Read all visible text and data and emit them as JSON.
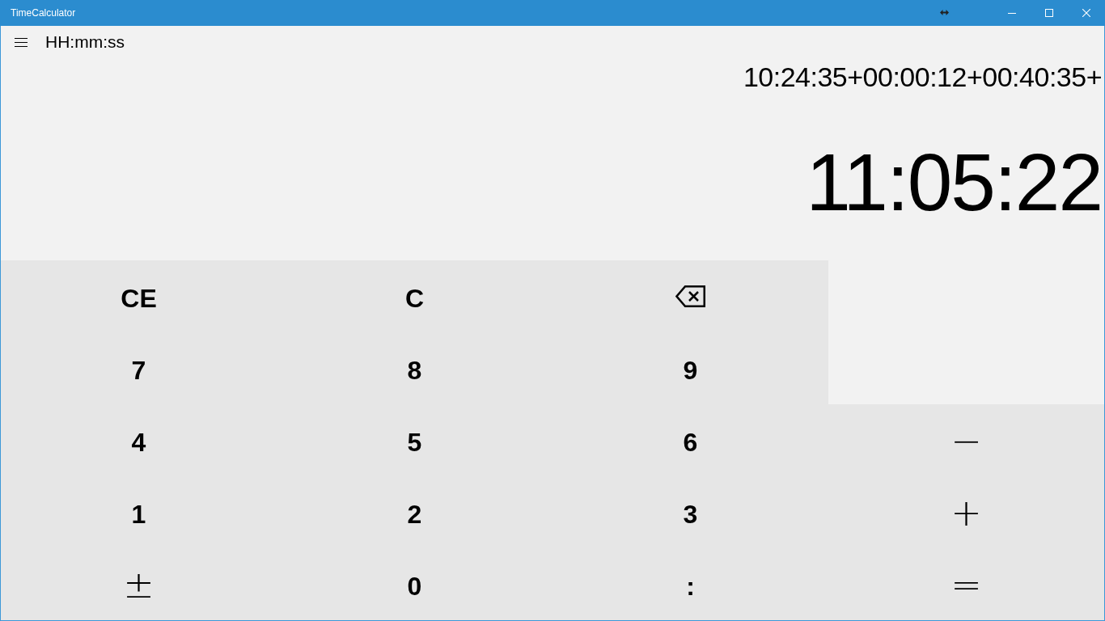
{
  "window": {
    "title": "TimeCalculator"
  },
  "header": {
    "format": "HH:mm:ss"
  },
  "display": {
    "expression": "10:24:35+00:00:12+00:40:35+",
    "result": "11:05:22"
  },
  "keypad": {
    "rows": [
      [
        {
          "kind": "label",
          "label": "CE"
        },
        {
          "kind": "label",
          "label": "C"
        },
        {
          "kind": "backspace"
        }
      ],
      [
        {
          "kind": "label",
          "label": "7"
        },
        {
          "kind": "label",
          "label": "8"
        },
        {
          "kind": "label",
          "label": "9"
        }
      ],
      [
        {
          "kind": "label",
          "label": "4"
        },
        {
          "kind": "label",
          "label": "5"
        },
        {
          "kind": "label",
          "label": "6"
        },
        {
          "kind": "symbol",
          "label": "−"
        }
      ],
      [
        {
          "kind": "label",
          "label": "1"
        },
        {
          "kind": "label",
          "label": "2"
        },
        {
          "kind": "label",
          "label": "3"
        },
        {
          "kind": "symbol",
          "label": "+"
        }
      ],
      [
        {
          "kind": "symbol",
          "label": "±"
        },
        {
          "kind": "label",
          "label": "0"
        },
        {
          "kind": "label",
          "label": ":"
        },
        {
          "kind": "symbol",
          "label": "="
        }
      ]
    ]
  }
}
